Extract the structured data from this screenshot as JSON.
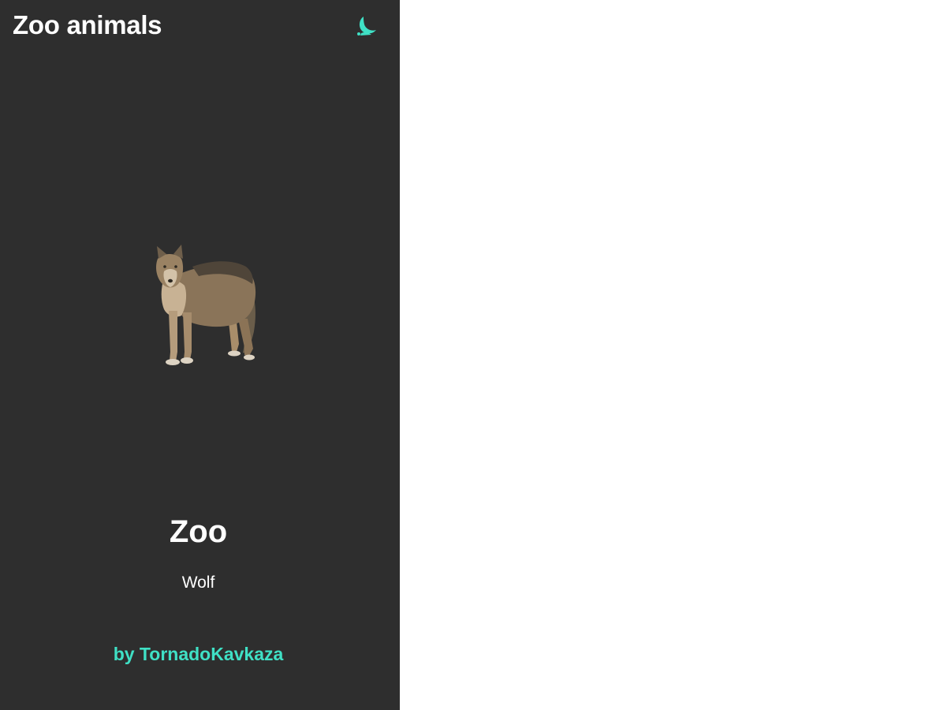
{
  "app": {
    "title": "Zoo animals"
  },
  "header": {
    "theme_icon": "moon-icon"
  },
  "main": {
    "heading": "Zoo",
    "animal_name": "Wolf",
    "animal_image": "wolf-image"
  },
  "footer": {
    "author": "by TornadoKavkaza"
  },
  "colors": {
    "panel_background": "#2e2e2e",
    "accent": "#3fe0c5",
    "text": "#ffffff",
    "page_background": "#ffffff"
  }
}
